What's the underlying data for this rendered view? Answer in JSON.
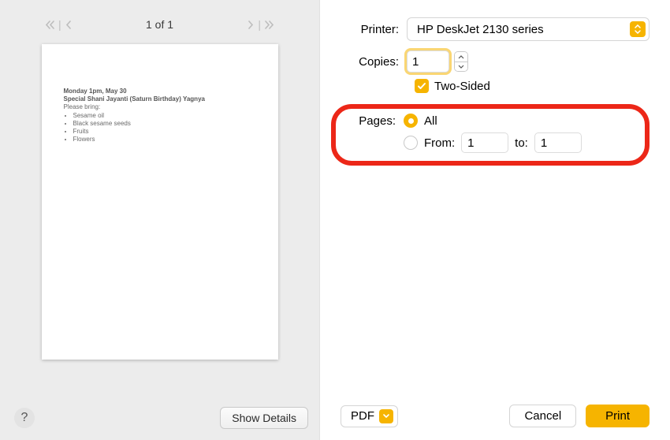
{
  "nav": {
    "page_count": "1 of 1"
  },
  "preview": {
    "line1": "Monday 1pm, May 30",
    "line2": "Special Shani Jayanti (Saturn Birthday) Yagnya",
    "line3": "Please bring:",
    "items": [
      "Sesame oil",
      "Black sesame seeds",
      "Fruits",
      "Flowers"
    ]
  },
  "left_buttons": {
    "help": "?",
    "show_details": "Show Details"
  },
  "printer": {
    "label": "Printer:",
    "value": "HP DeskJet 2130 series"
  },
  "copies": {
    "label": "Copies:",
    "value": "1",
    "two_sided": "Two-Sided"
  },
  "pages": {
    "label": "Pages:",
    "all": "All",
    "from_label": "From:",
    "from_value": "1",
    "to_label": "to:",
    "to_value": "1"
  },
  "bottom": {
    "pdf": "PDF",
    "cancel": "Cancel",
    "print": "Print"
  }
}
